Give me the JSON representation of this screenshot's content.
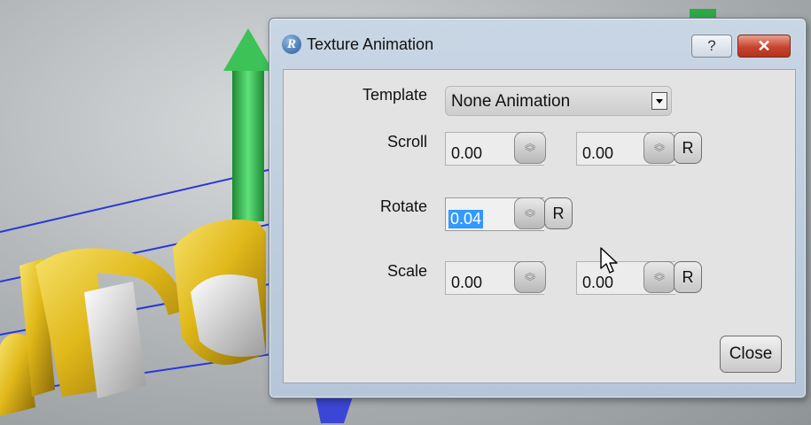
{
  "window": {
    "title": "Texture Animation",
    "app_icon_glyph": "R",
    "help_glyph": "?",
    "close_glyph": "✕"
  },
  "form": {
    "template": {
      "label": "Template",
      "selected": "None Animation"
    },
    "scroll": {
      "label": "Scroll",
      "u": "0.00",
      "v": "0.00",
      "reset": "R"
    },
    "rotate": {
      "label": "Rotate",
      "value": "0.04",
      "reset": "R"
    },
    "scale": {
      "label": "Scale",
      "u": "0.00",
      "v": "0.00",
      "reset": "R"
    }
  },
  "buttons": {
    "close": "Close"
  },
  "colors": {
    "selection": "#3399ff",
    "title_close": "#c8442f",
    "gizmo_green": "#2fb24a",
    "gizmo_blue": "#3b46d6",
    "gold": "#e0b81a"
  },
  "icons": [
    "app-logo-icon",
    "help-icon",
    "close-icon",
    "dropdown-arrow-icon",
    "spinner-icon",
    "mouse-pointer-icon"
  ]
}
